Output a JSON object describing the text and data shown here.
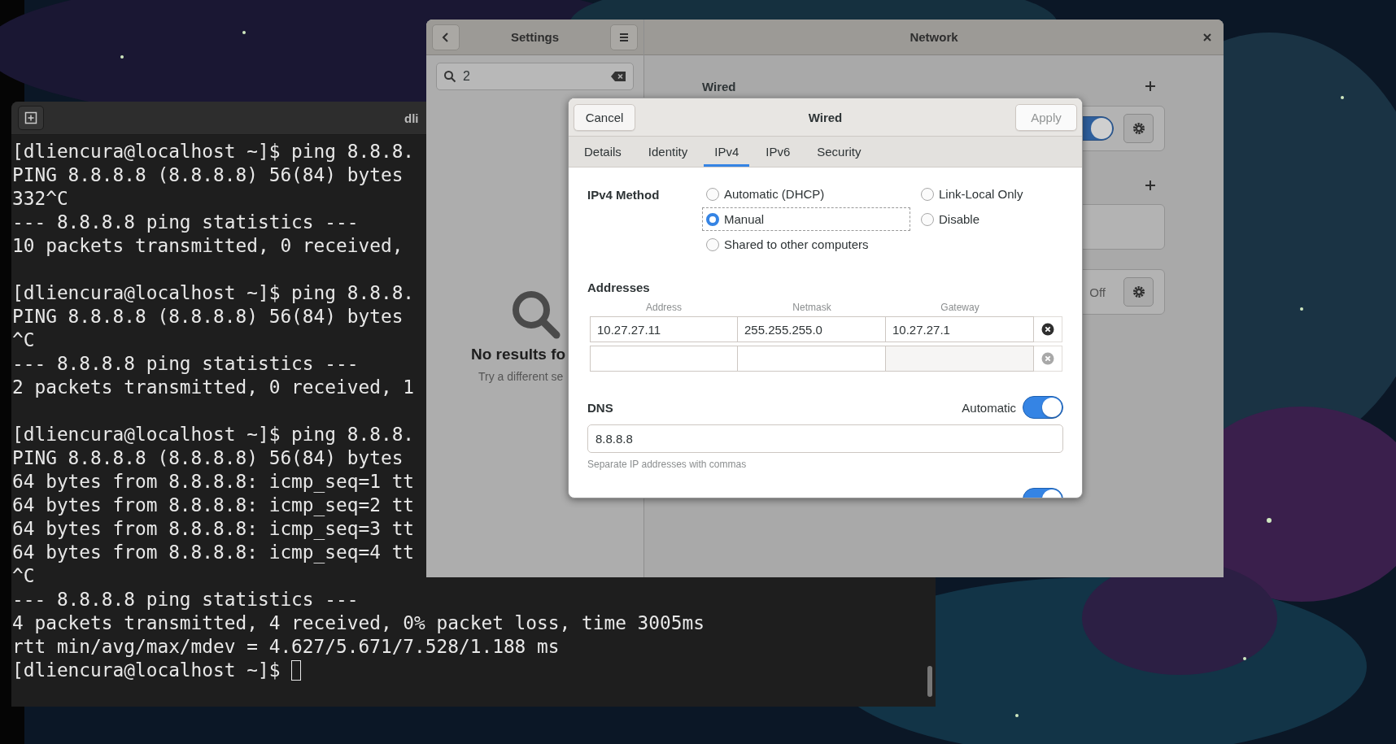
{
  "terminal": {
    "title": "dli",
    "blocks": [
      [
        "[dliencura@localhost ~]$ ping 8.8.8.",
        "PING 8.8.8.8 (8.8.8.8) 56(84) bytes",
        "332^C",
        "--- 8.8.8.8 ping statistics ---",
        "10 packets transmitted, 0 received,"
      ],
      [
        "[dliencura@localhost ~]$ ping 8.8.8.",
        "PING 8.8.8.8 (8.8.8.8) 56(84) bytes",
        "^C",
        "--- 8.8.8.8 ping statistics ---",
        "2 packets transmitted, 0 received, 1"
      ],
      [
        "[dliencura@localhost ~]$ ping 8.8.8.",
        "PING 8.8.8.8 (8.8.8.8) 56(84) bytes",
        "64 bytes from 8.8.8.8: icmp_seq=1 tt",
        "64 bytes from 8.8.8.8: icmp_seq=2 tt",
        "64 bytes from 8.8.8.8: icmp_seq=3 tt",
        "64 bytes from 8.8.8.8: icmp_seq=4 tt",
        "^C",
        "--- 8.8.8.8 ping statistics ---",
        "4 packets transmitted, 4 received, 0% packet loss, time 3005ms",
        "rtt min/avg/max/mdev = 4.627/5.671/7.528/1.188 ms",
        "[dliencura@localhost ~]$"
      ]
    ],
    "cursor": true
  },
  "settings": {
    "sidebar_title": "Settings",
    "search": {
      "value": "2"
    },
    "empty_state": {
      "title": "No results fo",
      "hint": "Try a different se"
    },
    "title": "Network",
    "wired_heading": "Wired",
    "cards": [
      {
        "kind": "toggle",
        "on": true
      },
      {
        "kind": "empty"
      },
      {
        "kind": "status",
        "status": "Off"
      }
    ]
  },
  "dialog": {
    "title": "Wired",
    "cancel": "Cancel",
    "apply": {
      "label": "Apply",
      "disabled": true
    },
    "tabs": [
      {
        "label": "Details",
        "selected": false
      },
      {
        "label": "Identity",
        "selected": false
      },
      {
        "label": "IPv4",
        "selected": true
      },
      {
        "label": "IPv6",
        "selected": false
      },
      {
        "label": "Security",
        "selected": false
      }
    ],
    "method": {
      "label": "IPv4 Method",
      "options": [
        {
          "label": "Automatic (DHCP)",
          "selected": false
        },
        {
          "label": "Link-Local Only",
          "selected": false
        },
        {
          "label": "Manual",
          "selected": true
        },
        {
          "label": "Disable",
          "selected": false
        },
        {
          "label": "Shared to other computers",
          "selected": false
        }
      ]
    },
    "addresses": {
      "heading": "Addresses",
      "columns": [
        "Address",
        "Netmask",
        "Gateway"
      ],
      "rows": [
        {
          "kind": "filled",
          "values": [
            "10.27.27.11",
            "255.255.255.0",
            "10.27.27.1"
          ]
        },
        {
          "kind": "blank"
        }
      ]
    },
    "dns": {
      "heading": "DNS",
      "automatic_label": "Automatic",
      "automatic": true,
      "value": "8.8.8.8",
      "hint": "Separate IP addresses with commas"
    },
    "routes_toggle": {
      "on": true
    }
  }
}
